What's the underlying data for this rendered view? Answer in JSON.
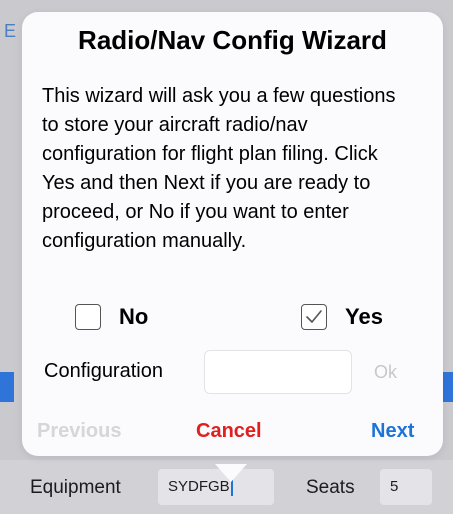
{
  "background": {
    "top_letter": "E",
    "equipment_label": "Equipment",
    "equipment_value": "SYDFGB",
    "seats_label": "Seats",
    "seats_value": "5"
  },
  "wizard": {
    "title": "Radio/Nav Config Wizard",
    "description": "This wizard will ask you a few questions to store your aircraft radio/nav configuration for flight plan filing. Click Yes and then Next if you are ready to proceed, or No if you want to enter configuration manually.",
    "options": [
      {
        "label": "No",
        "checked": false
      },
      {
        "label": "Yes",
        "checked": true
      }
    ],
    "configuration_label": "Configuration",
    "configuration_value": "",
    "ok_label": "Ok",
    "previous_label": "Previous",
    "cancel_label": "Cancel",
    "next_label": "Next"
  },
  "colors": {
    "accent": "#1d74d8",
    "danger": "#e0201f",
    "disabled": "#d6d6da"
  }
}
